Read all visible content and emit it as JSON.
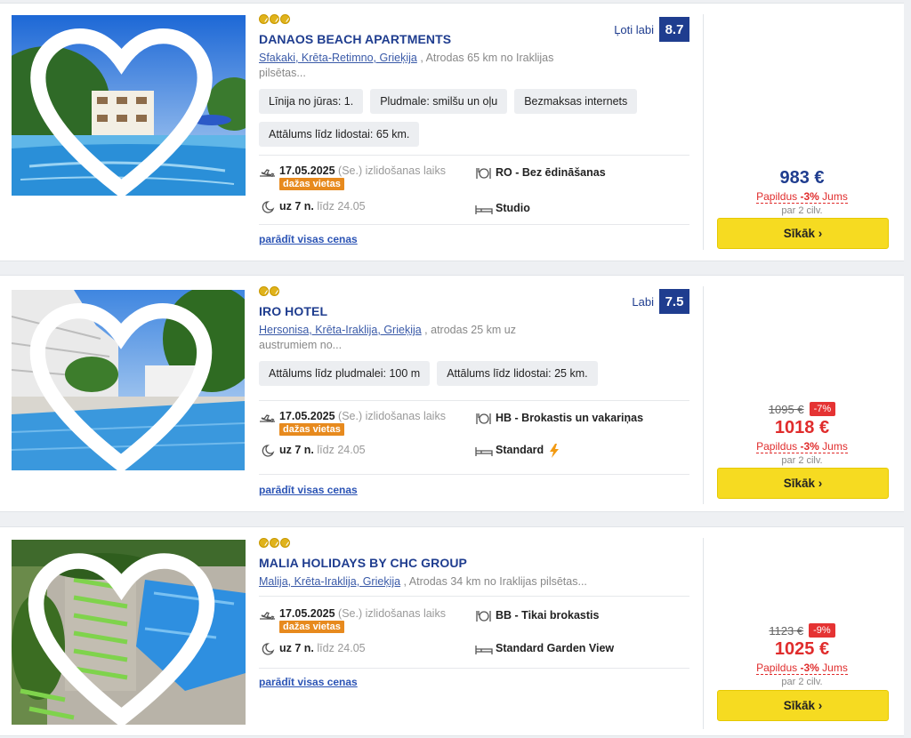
{
  "hotels": [
    {
      "name": "DANAOS BEACH APARTMENTS",
      "stars": 3,
      "location_link": "Sfakaki, Krēta-Retimno, Grieķija",
      "location_rest": " , Atrodas 65 km no Iraklijas pilsētas...",
      "rating_label": "Ļoti labi",
      "rating_score": "8.7",
      "chips": [
        "Līnija no jūras: 1.",
        "Pludmale: smilšu un oļu",
        "Bezmaksas internets",
        "Attālums līdz lidostai: 65 km."
      ],
      "date": "17.05.2025",
      "day": "(Se.)",
      "departure_label": "izlidošanas laiks",
      "few_seats": "dažas vietas",
      "duration": "uz 7 n.",
      "until": "līdz 24.05",
      "board": "RO - Bez ēdināšanas",
      "room": "Studio",
      "all_prices": "parādīt visas cenas",
      "old_price": "",
      "discount": "",
      "price": "983 €",
      "extra_pre": "Papildus ",
      "extra_pct": "-3%",
      "extra_post": " Jums",
      "per": "par 2 cilv.",
      "button": "Sīkāk ›"
    },
    {
      "name": "IRO HOTEL",
      "stars": 2,
      "location_link": "Hersonisa, Krēta-Iraklija, Grieķija",
      "location_rest": " , atrodas 25 km uz austrumiem no...",
      "rating_label": "Labi",
      "rating_score": "7.5",
      "chips": [
        "Attālums līdz pludmalei: 100 m",
        "Attālums līdz lidostai: 25 km."
      ],
      "date": "17.05.2025",
      "day": "(Se.)",
      "departure_label": "izlidošanas laiks",
      "few_seats": "dažas vietas",
      "duration": "uz 7 n.",
      "until": "līdz 24.05",
      "board": "HB - Brokastis un vakariņas",
      "room": "Standard",
      "all_prices": "parādīt visas cenas",
      "old_price": "1095 €",
      "discount": "-7%",
      "price": "1018 €",
      "extra_pre": "Papildus ",
      "extra_pct": "-3%",
      "extra_post": " Jums",
      "per": "par 2 cilv.",
      "button": "Sīkāk ›"
    },
    {
      "name": "MALIA HOLIDAYS BY CHC GROUP",
      "stars": 3,
      "location_link": "Malija, Krēta-Iraklija, Grieķija",
      "location_rest": " , Atrodas 34 km no Iraklijas pilsētas...",
      "rating_label": "",
      "rating_score": "",
      "chips": [],
      "date": "17.05.2025",
      "day": "(Se.)",
      "departure_label": "izlidošanas laiks",
      "few_seats": "dažas vietas",
      "duration": "uz 7 n.",
      "until": "līdz 24.05",
      "board": "BB - Tikai brokastis",
      "room": "Standard Garden View",
      "all_prices": "parādīt visas cenas",
      "old_price": "1123 €",
      "discount": "-9%",
      "price": "1025 €",
      "extra_pre": "Papildus ",
      "extra_pct": "-3%",
      "extra_post": " Jums",
      "per": "par 2 cilv.",
      "button": "Sīkāk ›"
    }
  ],
  "colors": {
    "brand": "#1f3d8f",
    "button": "#f6db21",
    "sale": "#e02c2c",
    "few_seats": "#e78a1e"
  },
  "icons": [
    "heart-icon",
    "plane-departure-icon",
    "moon-icon",
    "meal-icon",
    "bed-icon",
    "lightning-icon",
    "star-icon"
  ]
}
